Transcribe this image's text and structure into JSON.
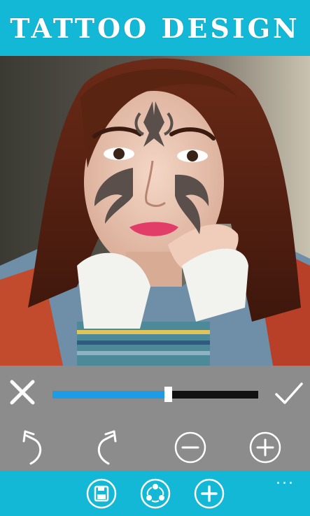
{
  "app": {
    "title": "TATTOO DESIGN"
  },
  "editor": {
    "opacity_slider": {
      "level_fraction": 0.56
    },
    "buttons": {
      "cancel": "close-icon",
      "apply": "checkmark-icon",
      "undo": "undo-icon",
      "redo": "redo-icon",
      "zoom_out": "zoom-out-icon",
      "zoom_in": "zoom-in-icon"
    }
  },
  "app_bar": {
    "buttons": {
      "save": "save-icon",
      "share": "share-icon",
      "add": "add-icon"
    },
    "more": "..."
  },
  "colors": {
    "accent": "#12b8d6",
    "toolbar_bg": "#8c8c8c",
    "slider_fill": "#1e9be6",
    "slider_track": "#111111"
  }
}
